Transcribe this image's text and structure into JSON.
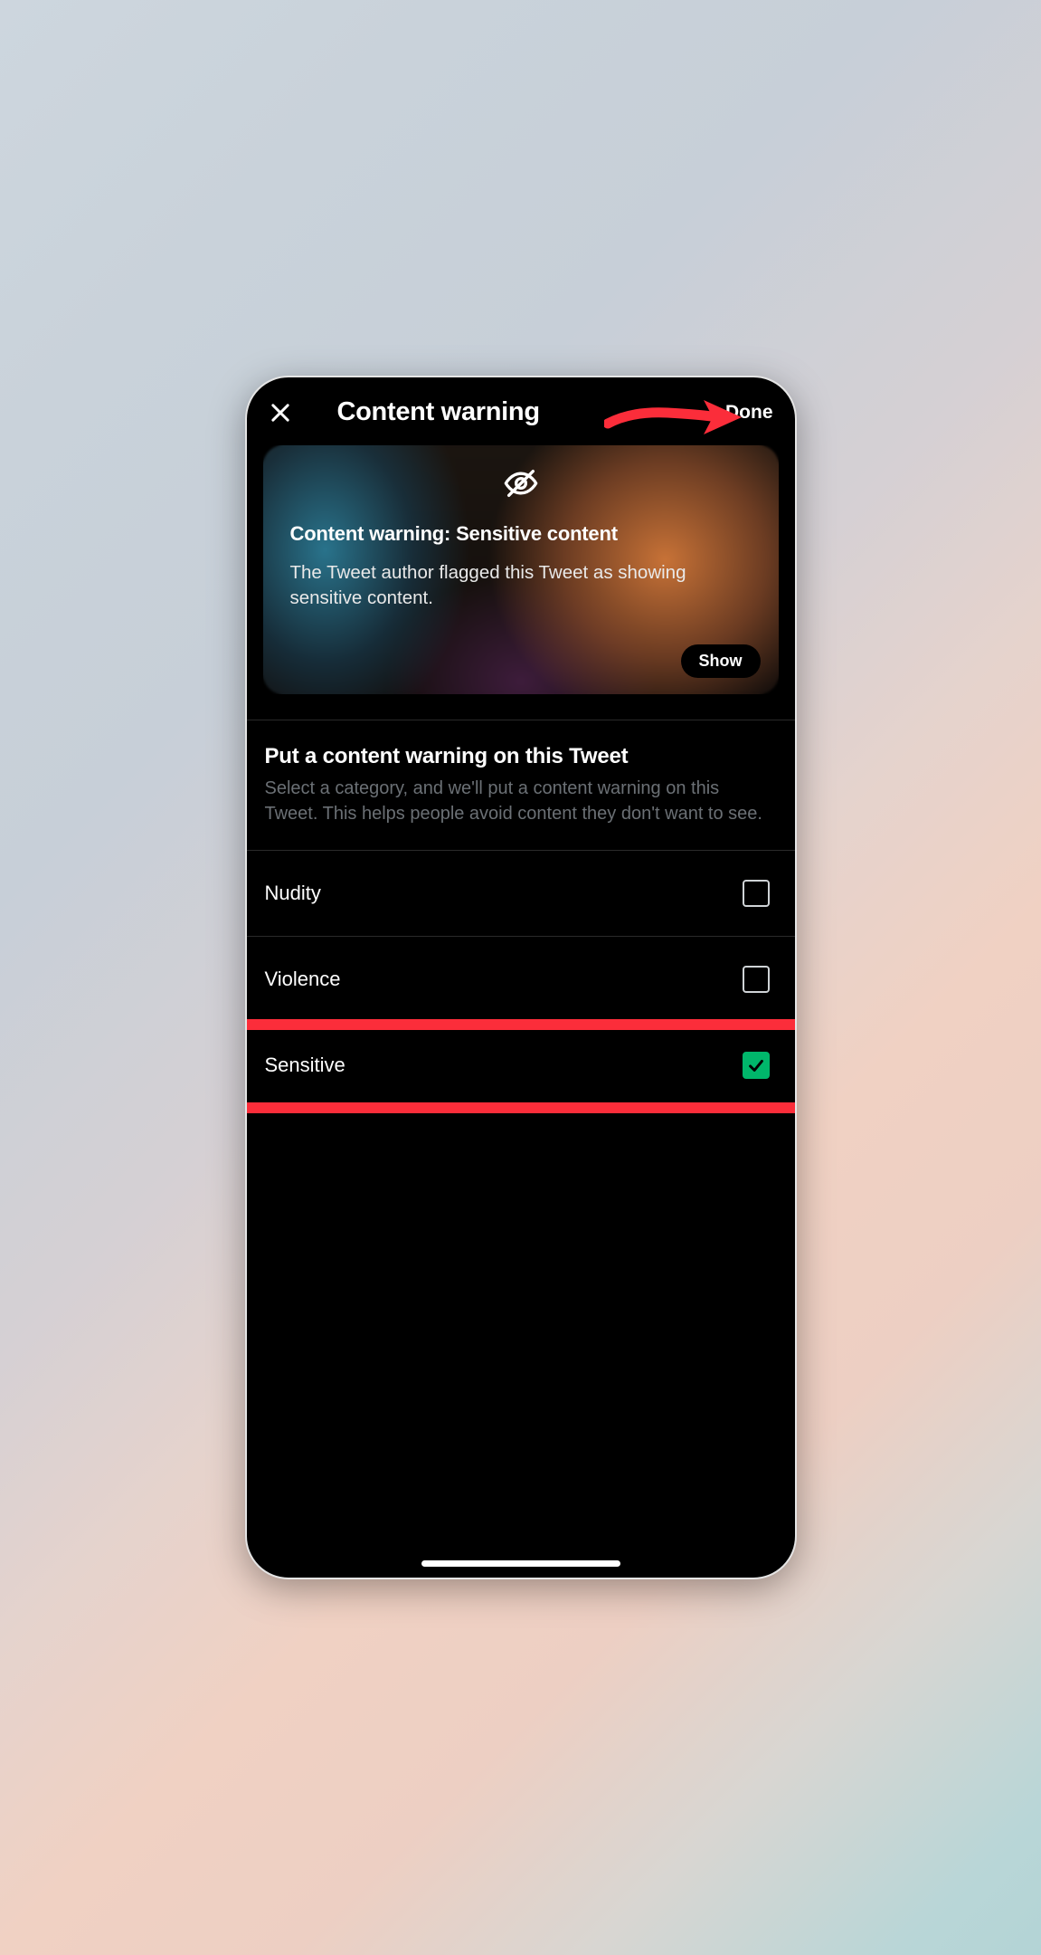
{
  "header": {
    "title": "Content warning",
    "done_label": "Done"
  },
  "preview": {
    "title": "Content warning: Sensitive content",
    "description": "The Tweet author flagged this Tweet as showing sensitive content.",
    "show_label": "Show"
  },
  "section": {
    "title": "Put a content warning on this Tweet",
    "description": "Select a category, and we'll put a content warning on this Tweet. This helps people avoid content they don't want to see."
  },
  "options": [
    {
      "label": "Nudity",
      "checked": false,
      "highlight": false
    },
    {
      "label": "Violence",
      "checked": false,
      "highlight": false
    },
    {
      "label": "Sensitive",
      "checked": true,
      "highlight": true
    }
  ],
  "annotations": {
    "arrow_color": "#fb2d3a",
    "highlight_color": "#fb2d3a"
  }
}
